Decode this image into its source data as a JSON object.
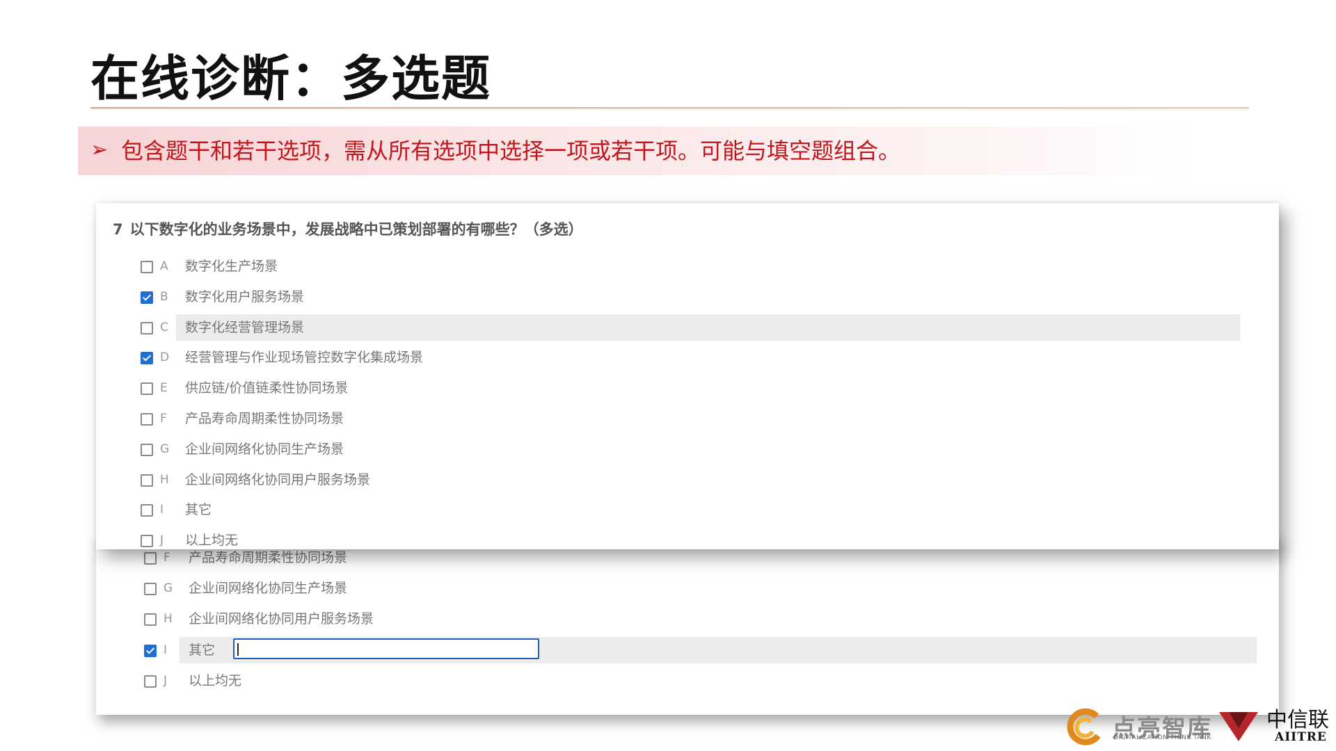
{
  "slide": {
    "title": "在线诊断：多选题",
    "banner_arrow": "➢",
    "banner_text": "包含题干和若干选项，需从所有选项中选择一项或若干项。可能与填空题组合。"
  },
  "question": {
    "number": "7",
    "text": "以下数字化的业务场景中，发展战略中已策划部署的有哪些？（多选）"
  },
  "options_front": [
    {
      "letter": "A",
      "label": "数字化生产场景",
      "checked": false
    },
    {
      "letter": "B",
      "label": "数字化用户服务场景",
      "checked": true
    },
    {
      "letter": "C",
      "label": "数字化经营管理场景",
      "checked": false,
      "highlight": true
    },
    {
      "letter": "D",
      "label": "经营管理与作业现场管控数字化集成场景",
      "checked": true
    },
    {
      "letter": "E",
      "label": "供应链/价值链柔性协同场景",
      "checked": false
    },
    {
      "letter": "F",
      "label": "产品寿命周期柔性协同场景",
      "checked": false
    },
    {
      "letter": "G",
      "label": "企业间网络化协同生产场景",
      "checked": false
    },
    {
      "letter": "H",
      "label": "企业间网络化协同用户服务场景",
      "checked": false
    },
    {
      "letter": "I",
      "label": "其它",
      "checked": false
    },
    {
      "letter": "J",
      "label": "以上均无",
      "checked": false
    }
  ],
  "options_back": [
    {
      "letter": "F",
      "label": "产品寿命周期柔性协同场景",
      "checked": false
    },
    {
      "letter": "G",
      "label": "企业间网络化协同生产场景",
      "checked": false
    },
    {
      "letter": "H",
      "label": "企业间网络化协同用户服务场景",
      "checked": false
    },
    {
      "letter": "I",
      "label": "其它",
      "checked": true,
      "highlight": true,
      "has_input": true,
      "input_value": ""
    },
    {
      "letter": "J",
      "label": "以上均无",
      "checked": false
    }
  ],
  "logos": {
    "logo1_text": "点亮智库",
    "logo1_sub": "DIGITALIZATION THINK TANK",
    "logo2_cn": "中信联",
    "logo2_en": "AIITRE"
  },
  "colors": {
    "accent_red": "#c0161c",
    "checkbox_blue": "#1f6fd1",
    "highlight_gray": "#ececec"
  }
}
